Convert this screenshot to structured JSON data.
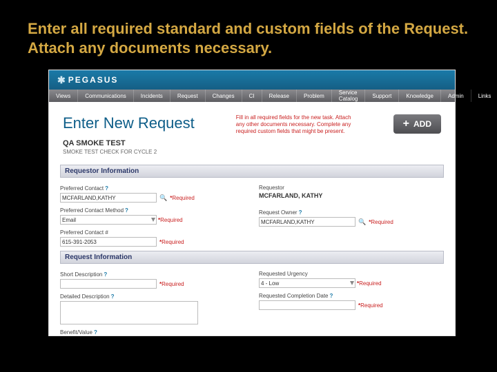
{
  "slide_title": "Enter all required standard and custom fields of the Request. Attach any documents necessary.",
  "brand": "PEGASUS",
  "nav": [
    "Views",
    "Communications",
    "Incidents",
    "Request",
    "Changes",
    "CI",
    "Release",
    "Problem",
    "Service Catalog",
    "Support",
    "Knowledge",
    "Admin",
    "Links"
  ],
  "page_title": "Enter New Request",
  "instructions": "Fill in all required fields for the new task. Attach any other documents necessary. Complete any required custom fields that might be present.",
  "add_btn": "ADD",
  "subtest_name": "QA SMOKE TEST",
  "subtest_desc": "SMOKE TEST CHECK FOR CYCLE 2",
  "sec1": "Requestor Information",
  "sec2": "Request Information",
  "req_text": "*Required",
  "left": {
    "pc_lbl": "Preferred Contact",
    "pc_val": "MCFARLAND,KATHY",
    "pcm_lbl": "Preferred Contact Method",
    "pcm_val": "Email",
    "pcn_lbl": "Preferred Contact #",
    "pcn_val": "615-391-2053",
    "sd_lbl": "Short Description",
    "dd_lbl": "Detailed Description",
    "bv_lbl": "Benefit/Value"
  },
  "right": {
    "rq_lbl": "Requestor",
    "rq_val": "MCFARLAND, KATHY",
    "ro_lbl": "Request Owner",
    "ro_val": "MCFARLAND,KATHY",
    "ru_lbl": "Requested Urgency",
    "ru_val": "4 - Low",
    "rc_lbl": "Requested Completion Date"
  }
}
